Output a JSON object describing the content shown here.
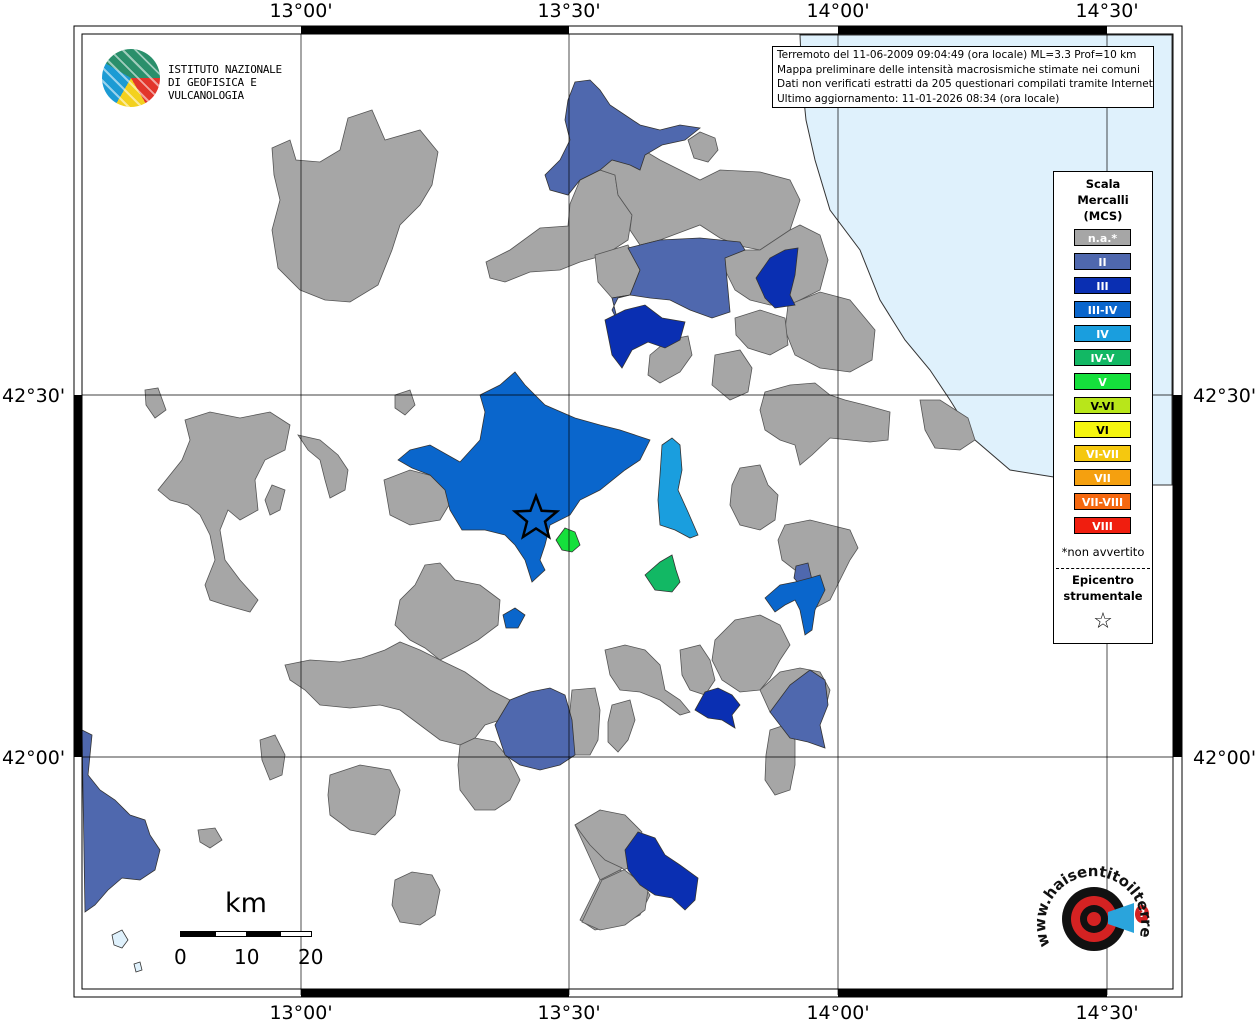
{
  "header": {
    "lon_labels": [
      "13°00'",
      "13°30'",
      "14°00'",
      "14°30'"
    ],
    "lat_labels": [
      "42°30'",
      "42°00'"
    ]
  },
  "logo": {
    "line1": "ISTITUTO NAZIONALE",
    "line2": "DI GEOFISICA E VULCANOLOGIA"
  },
  "info": {
    "line1": "Terremoto del 11-06-2009 09:04:49 (ora locale) ML=3.3 Prof=10 km",
    "line2": "Mappa preliminare delle intensità macrosismiche stimate nei comuni",
    "line3": "Dati non verificati estratti da 205 questionari compilati tramite Internet.",
    "line4": "Ultimo aggiornamento: 11-01-2026 08:34 (ora locale)"
  },
  "legend": {
    "title1": "Scala",
    "title2": "Mercalli",
    "title3": "(MCS)",
    "items": [
      {
        "label": "n.a.*",
        "color": "#a6a6a6"
      },
      {
        "label": "II",
        "color": "#4f68ae"
      },
      {
        "label": "III",
        "color": "#0a2fb2"
      },
      {
        "label": "III-IV",
        "color": "#0a66cc"
      },
      {
        "label": "IV",
        "color": "#1a9ede"
      },
      {
        "label": "IV-V",
        "color": "#12b864"
      },
      {
        "label": "V",
        "color": "#15e03c"
      },
      {
        "label": "V-VI",
        "color": "#b8e61a"
      },
      {
        "label": "VI",
        "color": "#f5f50f"
      },
      {
        "label": "VI-VII",
        "color": "#f5c80f"
      },
      {
        "label": "VII",
        "color": "#f5a00f"
      },
      {
        "label": "VII-VIII",
        "color": "#f5680f"
      },
      {
        "label": "VIII",
        "color": "#f01e0f"
      }
    ],
    "note": "*non avvertito",
    "epicentre1": "Epicentro",
    "epicentre2": "strumentale",
    "star": "☆"
  },
  "scalebar": {
    "unit": "km",
    "ticks": [
      "0",
      "10",
      "20"
    ]
  },
  "watermark": {
    "text": "www.haisentitoilterremoto.it",
    "q": "?"
  },
  "colors": {
    "sea": "#dff1fc",
    "na": "#a6a6a6",
    "II": "#4f68ae",
    "III": "#0a2fb2",
    "III_IV": "#0a66cc",
    "IV": "#1a9ede",
    "IV_V": "#12b864"
  }
}
